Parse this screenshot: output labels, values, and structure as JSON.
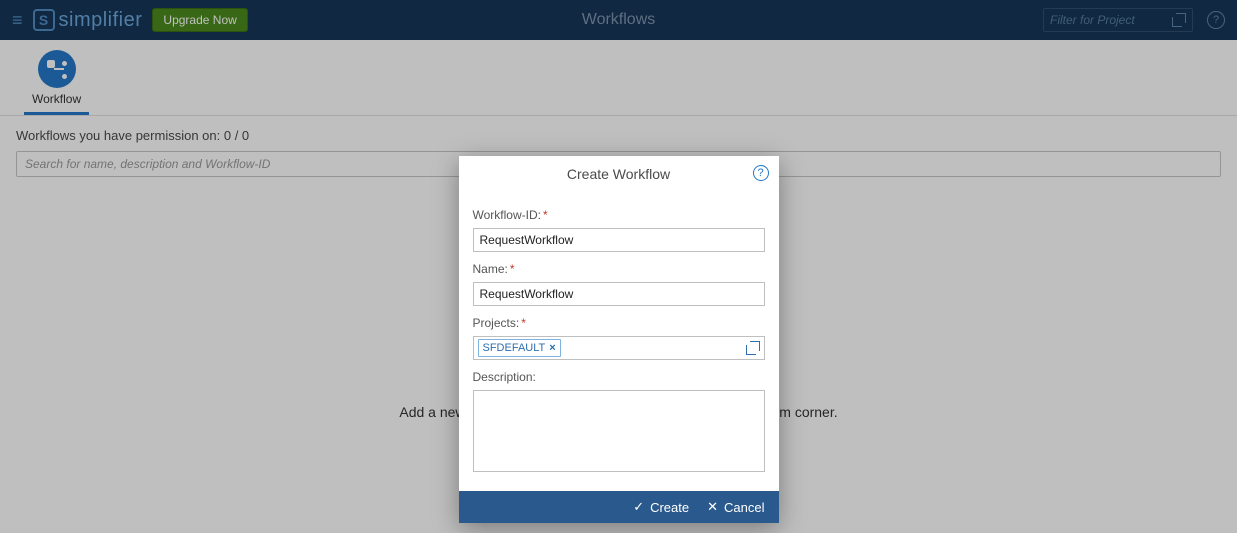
{
  "header": {
    "brand": "simplifier",
    "upgrade_label": "Upgrade Now",
    "page_title": "Workflows",
    "filter_placeholder": "Filter for Project"
  },
  "tabs": {
    "workflow_label": "Workflow"
  },
  "listing": {
    "permission_line": "Workflows you have permission on: 0 / 0",
    "search_placeholder": "Search for name, description and Workflow-ID",
    "empty_hint": "Add a new Workflow by clicking the + Button in the right bottom corner."
  },
  "dialog": {
    "title": "Create Workflow",
    "workflow_id_label": "Workflow-ID:",
    "workflow_id_value": "RequestWorkflow",
    "name_label": "Name:",
    "name_value": "RequestWorkflow",
    "projects_label": "Projects:",
    "project_chip": "SFDEFAULT",
    "description_label": "Description:",
    "create_label": "Create",
    "cancel_label": "Cancel"
  }
}
